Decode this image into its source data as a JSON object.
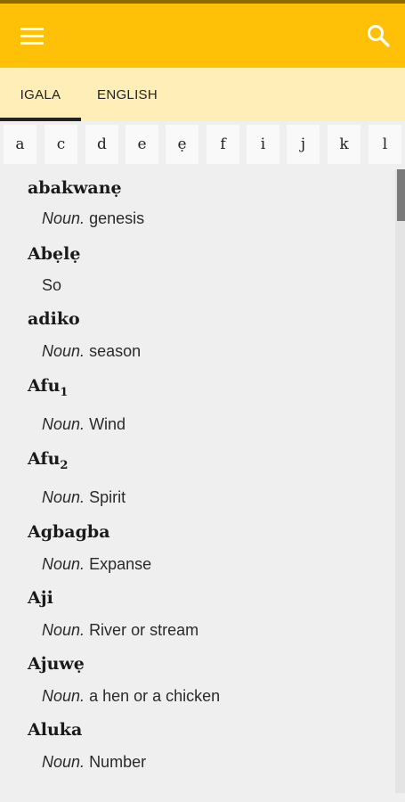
{
  "toolbar": {
    "menu_icon": "menu-icon",
    "search_icon": "search-icon",
    "background": "#ffc107"
  },
  "tabs": [
    {
      "label": "IGALA",
      "selected": true
    },
    {
      "label": "ENGLISH",
      "selected": false
    }
  ],
  "alphabet": [
    "a",
    "c",
    "d",
    "e",
    "ẹ",
    "f",
    "i",
    "j",
    "k",
    "l"
  ],
  "entries": [
    {
      "word": "abakwanẹ",
      "sub": "",
      "pos": "Noun.",
      "definition": "genesis"
    },
    {
      "word": "Abẹlẹ",
      "sub": "",
      "pos": "",
      "definition": "So"
    },
    {
      "word": "adiko",
      "sub": "",
      "pos": "Noun.",
      "definition": "season"
    },
    {
      "word": "Afu",
      "sub": "1",
      "pos": "Noun.",
      "definition": "Wind"
    },
    {
      "word": "Afu",
      "sub": "2",
      "pos": "Noun.",
      "definition": "Spirit"
    },
    {
      "word": "Agbagba",
      "sub": "",
      "pos": "Noun.",
      "definition": "Expanse"
    },
    {
      "word": "Aji",
      "sub": "",
      "pos": "Noun.",
      "definition": "River or stream"
    },
    {
      "word": "Ajuwẹ",
      "sub": "",
      "pos": "Noun.",
      "definition": "a hen or a chicken"
    },
    {
      "word": "Aluka",
      "sub": "",
      "pos": "Noun.",
      "definition": "Number"
    }
  ]
}
